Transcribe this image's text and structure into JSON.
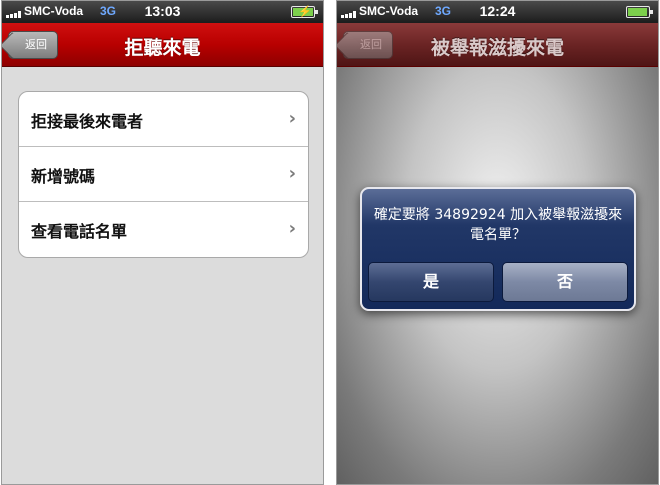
{
  "left_screen": {
    "status": {
      "carrier": "SMC-Voda",
      "network": "3G",
      "time": "13:03",
      "battery_level": 1.0,
      "charging": true
    },
    "nav": {
      "back_label": "返回",
      "title": "拒聽來電"
    },
    "rows": [
      {
        "label": "拒接最後來電者"
      },
      {
        "label": "新增號碼"
      },
      {
        "label": "查看電話名單"
      }
    ]
  },
  "right_screen": {
    "status": {
      "carrier": "SMC-Voda",
      "network": "3G",
      "time": "12:24",
      "battery_level": 0.95
    },
    "nav": {
      "back_label": "返回",
      "title": "被舉報滋擾來電"
    },
    "alert": {
      "message": "確定要將 34892924 加入被舉報滋擾來電名單？",
      "yes_label": "是",
      "no_label": "否"
    }
  },
  "icons": {
    "chevron": "chevron-right-icon",
    "signal": "signal-bars-icon",
    "battery": "battery-icon"
  },
  "colors": {
    "nav_red": "#b80000",
    "alert_blue": "#213767"
  }
}
